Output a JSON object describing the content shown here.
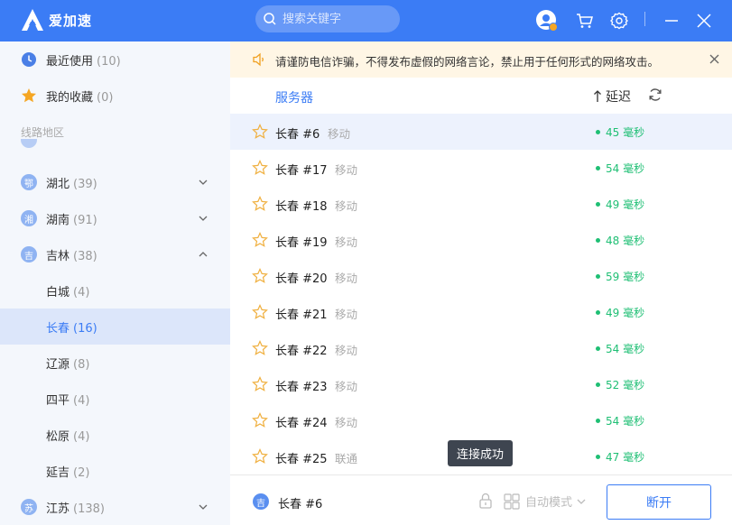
{
  "app": {
    "name": "爱加速",
    "logo_icon": "a-logo-icon",
    "brand_color": "#3b7cf5"
  },
  "search": {
    "placeholder": "搜索关键字"
  },
  "sidebar": {
    "recent": {
      "label": "最近使用",
      "count": "(10)"
    },
    "favorites": {
      "label": "我的收藏",
      "count": "(0)"
    },
    "section_title": "线路地区",
    "regions": [
      {
        "badge": "鄂",
        "label": "湖北",
        "count": "(39)"
      },
      {
        "badge": "湘",
        "label": "湖南",
        "count": "(91)"
      },
      {
        "badge": "吉",
        "label": "吉林",
        "count": "(38)"
      }
    ],
    "cities": [
      {
        "label": "白城",
        "count": "(4)"
      },
      {
        "label": "长春",
        "count": "(16)"
      },
      {
        "label": "辽源",
        "count": "(8)"
      },
      {
        "label": "四平",
        "count": "(4)"
      },
      {
        "label": "松原",
        "count": "(4)"
      },
      {
        "label": "延吉",
        "count": "(2)"
      }
    ],
    "last_region": {
      "badge": "苏",
      "label": "江苏",
      "count": "(138)"
    }
  },
  "notice": {
    "text": "请谨防电信诈骗，不得发布虚假的网络言论，禁止用于任何形式的网络攻击。"
  },
  "list": {
    "col_server": "服务器",
    "col_latency": "延迟",
    "rows": [
      {
        "name": "长春 #6",
        "isp": "移动",
        "latency": "45 毫秒"
      },
      {
        "name": "长春 #17",
        "isp": "移动",
        "latency": "54 毫秒"
      },
      {
        "name": "长春 #18",
        "isp": "移动",
        "latency": "49 毫秒"
      },
      {
        "name": "长春 #19",
        "isp": "移动",
        "latency": "48 毫秒"
      },
      {
        "name": "长春 #20",
        "isp": "移动",
        "latency": "59 毫秒"
      },
      {
        "name": "长春 #21",
        "isp": "移动",
        "latency": "49 毫秒"
      },
      {
        "name": "长春 #22",
        "isp": "移动",
        "latency": "54 毫秒"
      },
      {
        "name": "长春 #23",
        "isp": "移动",
        "latency": "52 毫秒"
      },
      {
        "name": "长春 #24",
        "isp": "移动",
        "latency": "54 毫秒"
      },
      {
        "name": "长春 #25",
        "isp": "联通",
        "latency": "47 毫秒"
      }
    ]
  },
  "tooltip": "连接成功",
  "bottom": {
    "current_badge": "吉",
    "current_name": "长春 #6",
    "mode": "自动模式",
    "disconnect": "断开"
  }
}
